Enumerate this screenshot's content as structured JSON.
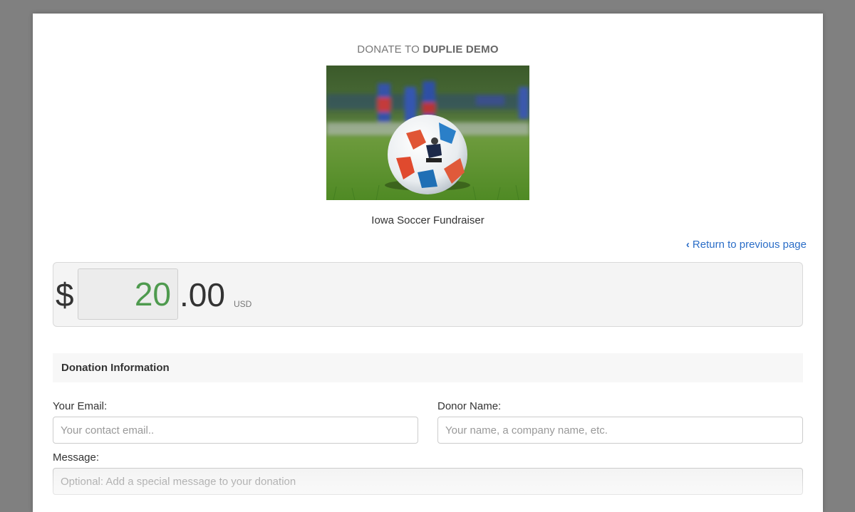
{
  "header": {
    "prefix": "DONATE TO",
    "org_name": "DUPLIE DEMO"
  },
  "campaign": {
    "image": "soccer-ball-photo",
    "name": "Iowa Soccer Fundraiser"
  },
  "back_link": {
    "icon": "chevron-left-icon",
    "label": "Return to previous page"
  },
  "amount": {
    "currency_symbol": "$",
    "value": "20",
    "cents": ".00",
    "currency_code": "USD"
  },
  "donation_info": {
    "title": "Donation Information",
    "email": {
      "label": "Your Email:",
      "placeholder": "Your contact email..",
      "value": ""
    },
    "donor_name": {
      "label": "Donor Name:",
      "placeholder": "Your name, a company name, etc.",
      "value": ""
    },
    "message": {
      "label": "Message:",
      "placeholder": "Optional: Add a special message to your donation",
      "value": ""
    }
  },
  "colors": {
    "background": "#808080",
    "link": "#2a6dc7",
    "amount_text": "#4e9a4e"
  }
}
